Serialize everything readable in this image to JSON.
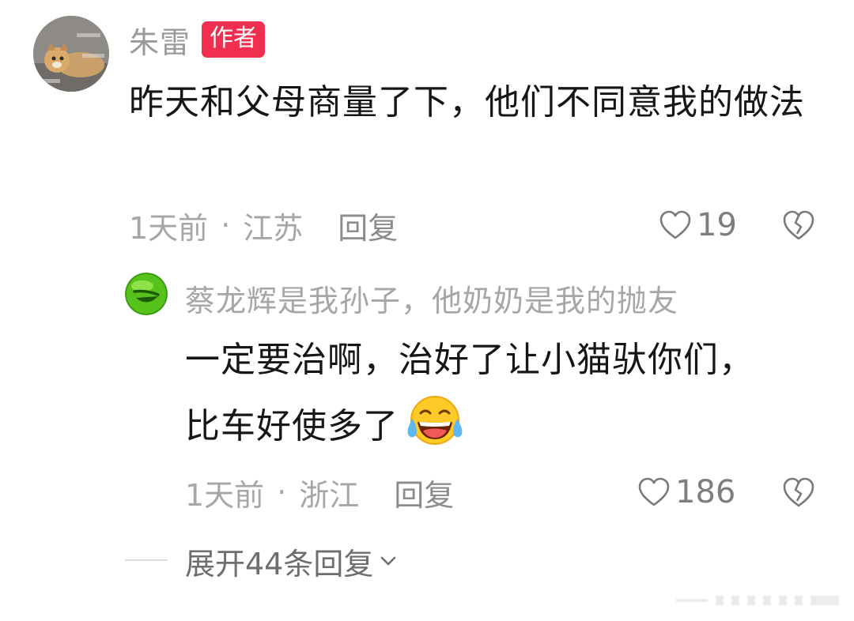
{
  "main_comment": {
    "username": "朱雷",
    "author_badge": "作者",
    "text": "昨天和父母商量了下，他们不同意我的做法",
    "time": "1天前",
    "location": "江苏",
    "reply_label": "回复",
    "likes": "19"
  },
  "reply": {
    "username": "蔡龙辉是我孙子，他奶奶是我的抛友",
    "text": "一定要治啊，治好了让小猫驮你们，比车好使多了",
    "emoji": "laughing-crying-emoji",
    "time": "1天前",
    "location": "浙江",
    "reply_label": "回复",
    "likes": "186"
  },
  "expand": {
    "label": "展开44条回复"
  },
  "meta": {
    "separator": "·"
  },
  "icons": {
    "like": "heart-outline-icon",
    "dislike": "broken-heart-icon",
    "expand": "chevron-down-icon"
  },
  "colors": {
    "author_badge": "#f02e4f",
    "text": "#161616",
    "muted": "#a6a6a6"
  }
}
